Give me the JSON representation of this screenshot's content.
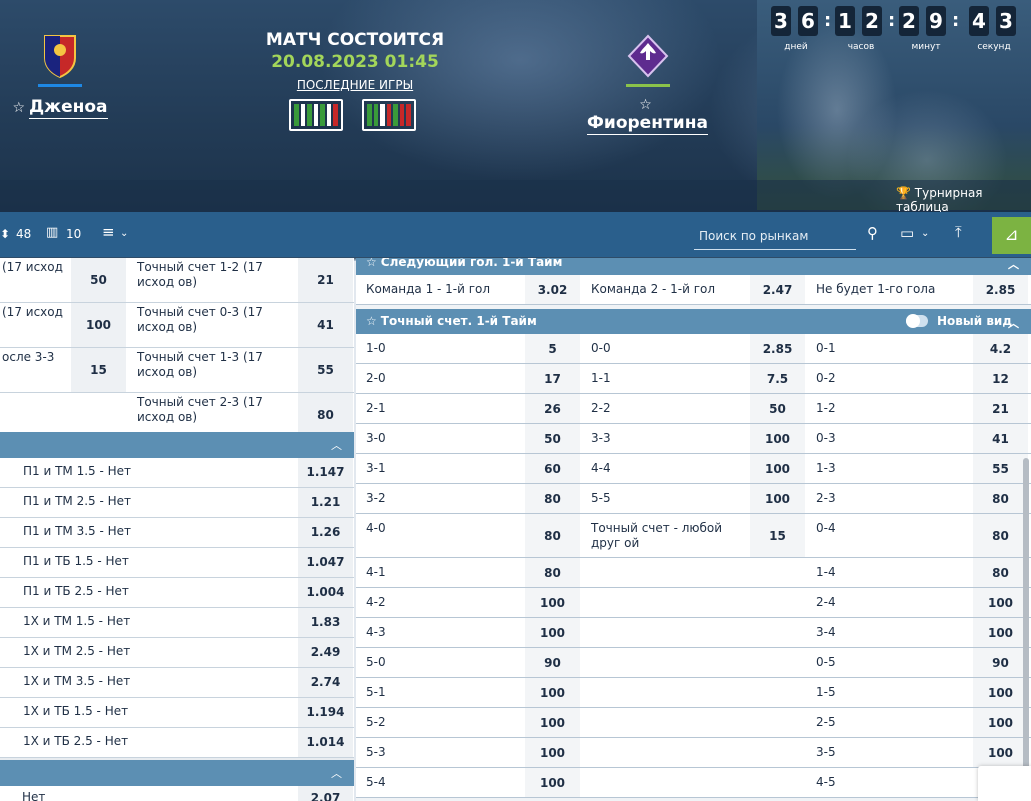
{
  "header": {
    "status": "МАТЧ СОСТОИТСЯ",
    "datetime": "20.08.2023 01:45",
    "last_games": "ПОСЛЕДНИЕ ИГРЫ",
    "home": {
      "name": "Дженоа",
      "color": "#1e88e5"
    },
    "away": {
      "name": "Фиорентина",
      "color": "#8bc34a"
    },
    "countdown": {
      "days": [
        "3",
        "6"
      ],
      "hours": [
        "1",
        "2"
      ],
      "minutes": [
        "2",
        "9"
      ],
      "seconds": [
        "4",
        "3"
      ],
      "days_label": "дней",
      "hours_label": "часов",
      "minutes_label": "минут",
      "seconds_label": "секунд"
    },
    "tournament_label": "Турнирная таблица"
  },
  "toolbar": {
    "count_a": "48",
    "count_b": "10",
    "search_placeholder": "Поиск по рынкам"
  },
  "left_panel": {
    "score_rows": [
      {
        "a": "(17 исход",
        "va": "50",
        "b": "Точный счет 1-2 (17 исход ов)",
        "vb": "21"
      },
      {
        "a": "(17 исход",
        "va": "100",
        "b": "Точный счет 0-3 (17 исход ов)",
        "vb": "41"
      },
      {
        "a": "осле 3-3",
        "va": "15",
        "b": "Точный счет 1-3 (17 исход ов)",
        "vb": "55"
      },
      {
        "a": "",
        "va": "",
        "b": "Точный счет 2-3 (17 исход ов)",
        "vb": "80"
      }
    ],
    "combo_rows": [
      {
        "label": "П1 и ТМ 1.5 - Нет",
        "value": "1.147"
      },
      {
        "label": "П1 и ТМ 2.5 - Нет",
        "value": "1.21"
      },
      {
        "label": "П1 и ТМ 3.5 - Нет",
        "value": "1.26"
      },
      {
        "label": "П1 и ТБ 1.5 - Нет",
        "value": "1.047"
      },
      {
        "label": "П1 и ТБ 2.5 - Нет",
        "value": "1.004"
      },
      {
        "label": "1Х и ТМ 1.5 - Нет",
        "value": "1.83"
      },
      {
        "label": "1Х и ТМ 2.5 - Нет",
        "value": "2.49"
      },
      {
        "label": "1Х и ТМ 3.5 - Нет",
        "value": "2.74"
      },
      {
        "label": "1Х и ТБ 1.5 - Нет",
        "value": "1.194"
      },
      {
        "label": "1Х и ТБ 2.5 - Нет",
        "value": "1.014"
      }
    ],
    "last_row": {
      "label": "Нет",
      "value": "2.07"
    }
  },
  "next_goal": {
    "title": "Следующий гол. 1-й Тайм",
    "cells": [
      {
        "label": "Команда 1 - 1-й гол",
        "value": "3.02"
      },
      {
        "label": "Команда 2 - 1-й гол",
        "value": "2.47"
      },
      {
        "label": "Не будет 1-го гола",
        "value": "2.85"
      }
    ]
  },
  "exact_score": {
    "title": "Точный счет. 1-й Тайм",
    "new_view": "Новый вид",
    "rows": [
      {
        "a": "1-0",
        "va": "5",
        "b": "0-0",
        "vb": "2.85",
        "c": "0-1",
        "vc": "4.2"
      },
      {
        "a": "2-0",
        "va": "17",
        "b": "1-1",
        "vb": "7.5",
        "c": "0-2",
        "vc": "12"
      },
      {
        "a": "2-1",
        "va": "26",
        "b": "2-2",
        "vb": "50",
        "c": "1-2",
        "vc": "21"
      },
      {
        "a": "3-0",
        "va": "50",
        "b": "3-3",
        "vb": "100",
        "c": "0-3",
        "vc": "41"
      },
      {
        "a": "3-1",
        "va": "60",
        "b": "4-4",
        "vb": "100",
        "c": "1-3",
        "vc": "55"
      },
      {
        "a": "3-2",
        "va": "80",
        "b": "5-5",
        "vb": "100",
        "c": "2-3",
        "vc": "80"
      },
      {
        "a": "4-0",
        "va": "80",
        "b": "Точный счет - любой друг ой",
        "vb": "15",
        "c": "0-4",
        "vc": "80"
      },
      {
        "a": "4-1",
        "va": "80",
        "b": "",
        "vb": "",
        "c": "1-4",
        "vc": "80"
      },
      {
        "a": "4-2",
        "va": "100",
        "b": "",
        "vb": "",
        "c": "2-4",
        "vc": "100"
      },
      {
        "a": "4-3",
        "va": "100",
        "b": "",
        "vb": "",
        "c": "3-4",
        "vc": "100"
      },
      {
        "a": "5-0",
        "va": "90",
        "b": "",
        "vb": "",
        "c": "0-5",
        "vc": "90"
      },
      {
        "a": "5-1",
        "va": "100",
        "b": "",
        "vb": "",
        "c": "1-5",
        "vc": "100"
      },
      {
        "a": "5-2",
        "va": "100",
        "b": "",
        "vb": "",
        "c": "2-5",
        "vc": "100"
      },
      {
        "a": "5-3",
        "va": "100",
        "b": "",
        "vb": "",
        "c": "3-5",
        "vc": "100"
      },
      {
        "a": "5-4",
        "va": "100",
        "b": "",
        "vb": "",
        "c": "4-5",
        "vc": ""
      }
    ]
  }
}
